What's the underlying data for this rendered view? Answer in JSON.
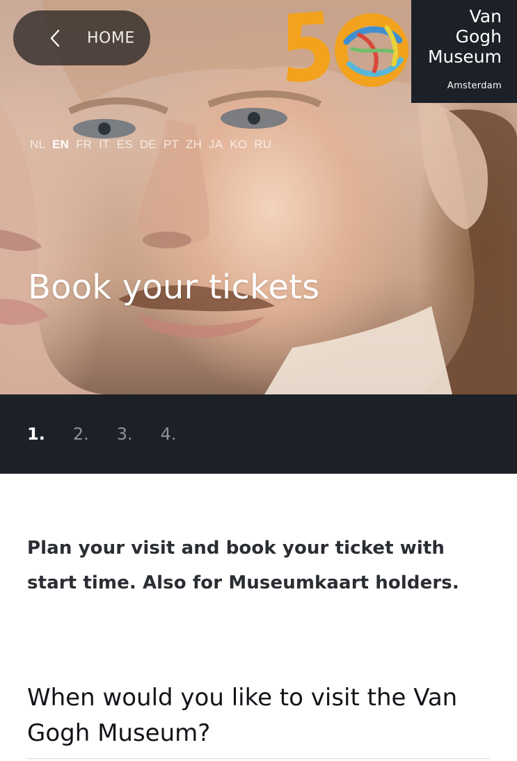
{
  "header": {
    "home_label": "HOME",
    "brand": {
      "line1": "Van",
      "line2": "Gogh",
      "line3": "Museum",
      "city": "Amsterdam"
    },
    "anniversary_logo": "50",
    "languages": [
      {
        "code": "NL",
        "active": false
      },
      {
        "code": "EN",
        "active": true
      },
      {
        "code": "FR",
        "active": false
      },
      {
        "code": "IT",
        "active": false
      },
      {
        "code": "ES",
        "active": false
      },
      {
        "code": "DE",
        "active": false
      },
      {
        "code": "PT",
        "active": false
      },
      {
        "code": "ZH",
        "active": false
      },
      {
        "code": "JA",
        "active": false
      },
      {
        "code": "KO",
        "active": false
      },
      {
        "code": "RU",
        "active": false
      }
    ],
    "title": "Book your tickets"
  },
  "steps": {
    "items": [
      "1.",
      "2.",
      "3.",
      "4."
    ],
    "current": 1
  },
  "content": {
    "intro": "Plan your visit and book your ticket with start time. Also for Museumkaart holders.",
    "question": "When would you like to visit the Van Gogh Museum?"
  },
  "colors": {
    "dark": "#1c2128",
    "logo_orange": "#f2a21c",
    "logo_blue": "#3f8fd0"
  }
}
